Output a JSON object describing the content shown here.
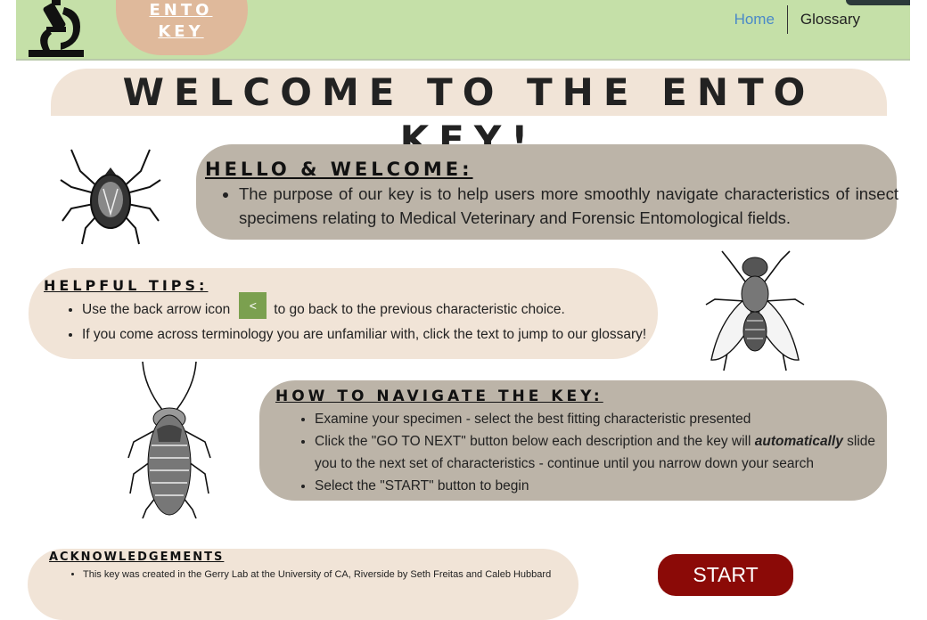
{
  "header": {
    "brand_line1": "ENTO",
    "brand_line2": "KEY",
    "nav": [
      {
        "label": "Home"
      },
      {
        "label": "Glossary"
      }
    ],
    "logo_icon": "microscope-icon"
  },
  "welcome_title": "WELCOME TO THE ENTO KEY!",
  "hello": {
    "heading": "HELLO & WELCOME:",
    "bullet": "The purpose of our key is to help users more smoothly navigate characteristics of insect specimens relating to Medical Veterinary and Forensic Entomological fields."
  },
  "tips": {
    "heading": "HELPFUL TIPS:",
    "tip1_before": "Use the back arrow icon",
    "back_icon": "<",
    "tip1_after": "to go back to the previous characteristic choice.",
    "tip2": "If you come across terminology you are unfamiliar with, click the text to jump to our glossary!"
  },
  "navigate": {
    "heading": "HOW TO NAVIGATE THE KEY:",
    "b1": "Examine your specimen - select the best fitting characteristic presented",
    "b2_before": "Click the \"GO TO NEXT\" button below each description and the key will ",
    "b2_emph": "automatically",
    "b2_after": " slide you to the next set of characteristics - continue until you narrow down your search",
    "b3": "Select the \"START\" button to begin"
  },
  "ack": {
    "heading": "ACKNOWLEDGEMENTS",
    "b1": "This key was created in the Gerry Lab at the University of CA, Riverside by Seth Freitas and Caleb Hubbard"
  },
  "start_label": "START",
  "illustrations": [
    "tick-illustration",
    "fly-illustration",
    "cockroach-illustration"
  ],
  "colors": {
    "header_bg": "#c5e0a8",
    "brand_pill": "#dfb99b",
    "beige": "#f1e4d7",
    "taupe": "#bcb4a8",
    "start_button": "#8b0a07",
    "back_button": "#7ba04f",
    "link": "#4a89c8"
  }
}
